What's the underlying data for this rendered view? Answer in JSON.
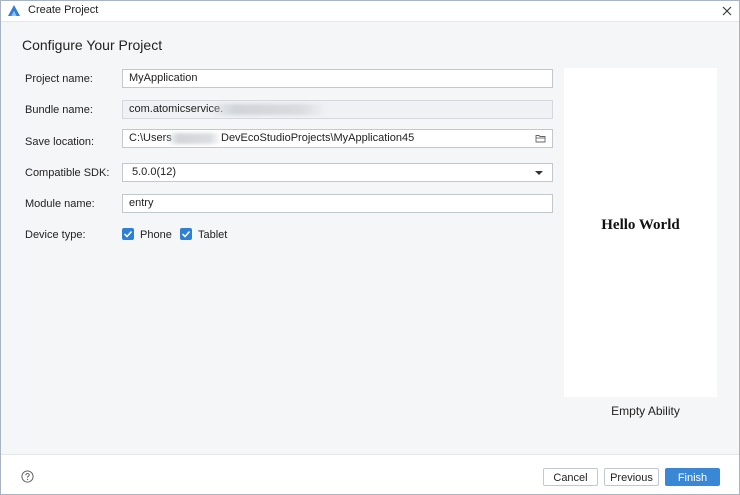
{
  "window": {
    "title": "Create Project",
    "icon": "deveco-logo-icon",
    "close_icon": "close-icon"
  },
  "page": {
    "heading": "Configure Your Project"
  },
  "form": {
    "project_name": {
      "label": "Project name:",
      "value": "MyApplication"
    },
    "bundle_name": {
      "label": "Bundle name:",
      "value": "com.atomicservice."
    },
    "save_location": {
      "label": "Save location:",
      "value_prefix": "C:\\Users",
      "value_suffix": "DevEcoStudioProjects\\MyApplication45",
      "icon": "folder-icon"
    },
    "compatible_sdk": {
      "label": "Compatible SDK:",
      "value": "5.0.0(12)"
    },
    "module_name": {
      "label": "Module name:",
      "value": "entry"
    },
    "device_type": {
      "label": "Device type:",
      "options": [
        {
          "label": "Phone",
          "checked": true
        },
        {
          "label": "Tablet",
          "checked": true
        }
      ]
    }
  },
  "preview": {
    "text": "Hello World",
    "template_name": "Empty Ability"
  },
  "footer": {
    "help_icon": "help-icon",
    "cancel_label": "Cancel",
    "previous_label": "Previous",
    "finish_label": "Finish"
  },
  "colors": {
    "accent": "#3a87d6",
    "checkbox": "#2e7fd6",
    "panel_bg": "#f5f6f8"
  }
}
